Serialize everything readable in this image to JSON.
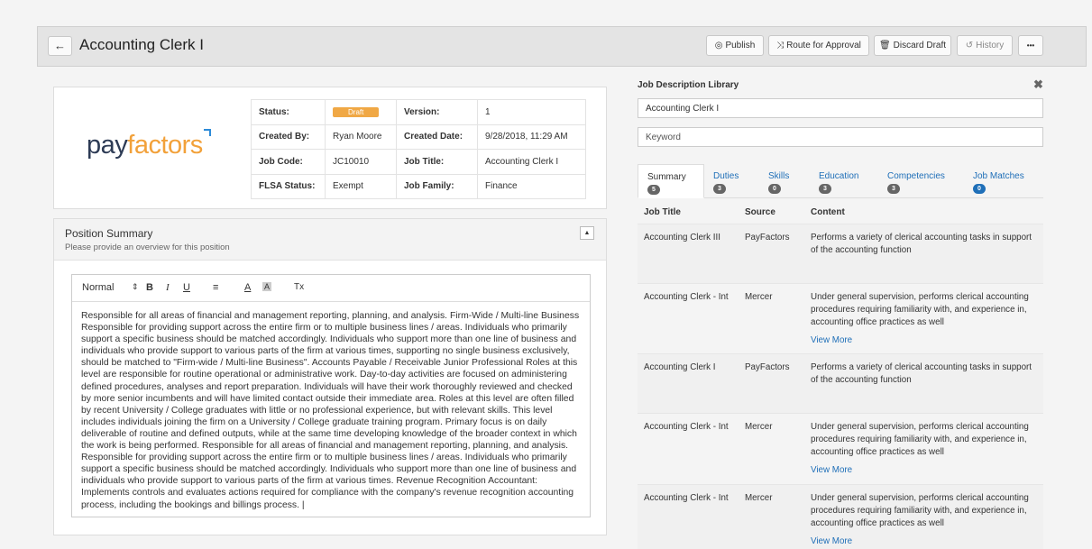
{
  "header": {
    "back_label": "←",
    "title": "Accounting Clerk I",
    "buttons": {
      "publish": "Publish",
      "route": "Route for Approval",
      "discard": "Discard Draft",
      "history": "History",
      "more": "•••"
    }
  },
  "logo": {
    "part1": "pay",
    "part2": "factors"
  },
  "meta": {
    "status_label": "Status:",
    "status_value": "Draft",
    "version_label": "Version:",
    "version_value": "1",
    "created_by_label": "Created By:",
    "created_by_value": "Ryan Moore",
    "created_date_label": "Created Date:",
    "created_date_value": "9/28/2018, 11:29 AM",
    "job_code_label": "Job Code:",
    "job_code_value": "JC10010",
    "job_title_label": "Job Title:",
    "job_title_value": "Accounting Clerk I",
    "flsa_label": "FLSA Status:",
    "flsa_value": "Exempt",
    "job_family_label": "Job Family:",
    "job_family_value": "Finance"
  },
  "position": {
    "title": "Position Summary",
    "subtitle": "Please provide an overview for this position",
    "collapse": "▲",
    "toolbar": {
      "style": "Normal",
      "arrows": "⇕",
      "bold": "B",
      "italic": "I",
      "underline": "U",
      "align": "≡",
      "color": "A",
      "bg": "A",
      "clear": "Tx"
    },
    "text": "Responsible for all areas of financial and management reporting, planning, and analysis. Firm-Wide / Multi-line Business Responsible for providing support across the entire firm or to multiple business lines / areas. Individuals who primarily support a specific business should be matched accordingly. Individuals who support more than one line of business and individuals who provide support to various parts of the firm at various times, supporting no single business exclusively, should be matched to \"Firm-wide / Multi-line Business\". Accounts Payable / Receivable Junior Professional Roles at this level are responsible for routine operational or administrative work. Day-to-day activities are focused on administering defined procedures, analyses and report preparation. Individuals will have their work thoroughly reviewed and checked by more senior incumbents and will have limited contact outside their immediate area. Roles at this level are often filled by recent University / College graduates with little or no professional experience, but with relevant skills. This level includes individuals joining the firm on a University / College graduate training program. Primary focus is on daily deliverable of routine and defined outputs, while at the same time developing knowledge of the broader context in which the work is being performed. Responsible for all areas of financial and management reporting, planning, and analysis. Responsible for providing support across the entire firm or to multiple business lines / areas. Individuals who primarily support a specific business should be matched accordingly. Individuals who support more than one line of business and individuals who provide support to various parts of the firm at various times. Revenue Recognition Accountant: Implements controls and evaluates actions required for compliance with the company's revenue recognition accounting process, including the bookings and billings process. |"
  },
  "library": {
    "title": "Job Description Library",
    "close": "✖",
    "search_value": "Accounting Clerk I",
    "keyword_placeholder": "Keyword",
    "tabs": [
      {
        "label": "Summary",
        "count": "5"
      },
      {
        "label": "Duties",
        "count": "3"
      },
      {
        "label": "Skills",
        "count": "0"
      },
      {
        "label": "Education",
        "count": "3"
      },
      {
        "label": "Competencies",
        "count": "3"
      },
      {
        "label": "Job Matches",
        "count": "0"
      }
    ],
    "columns": {
      "job_title": "Job Title",
      "source": "Source",
      "content": "Content"
    },
    "rows": [
      {
        "title": "Accounting Clerk III",
        "source": "PayFactors",
        "content": "Performs a variety of clerical accounting tasks in support of the accounting function",
        "more": ""
      },
      {
        "title": "Accounting Clerk - Int",
        "source": "Mercer",
        "content": "Under general supervision, performs clerical accounting procedures requiring familiarity with, and experience in, accounting office practices as well",
        "more": "View More"
      },
      {
        "title": "Accounting Clerk I",
        "source": "PayFactors",
        "content": "Performs a variety of clerical accounting tasks in support of the accounting function",
        "more": ""
      },
      {
        "title": "Accounting Clerk - Int",
        "source": "Mercer",
        "content": "Under general supervision, performs clerical accounting procedures requiring familiarity with, and experience in, accounting office practices as well",
        "more": "View More"
      },
      {
        "title": "Accounting Clerk - Int",
        "source": "Mercer",
        "content": "Under general supervision, performs clerical accounting procedures requiring familiarity with, and experience in, accounting office practices as well",
        "more": "View More"
      }
    ]
  }
}
